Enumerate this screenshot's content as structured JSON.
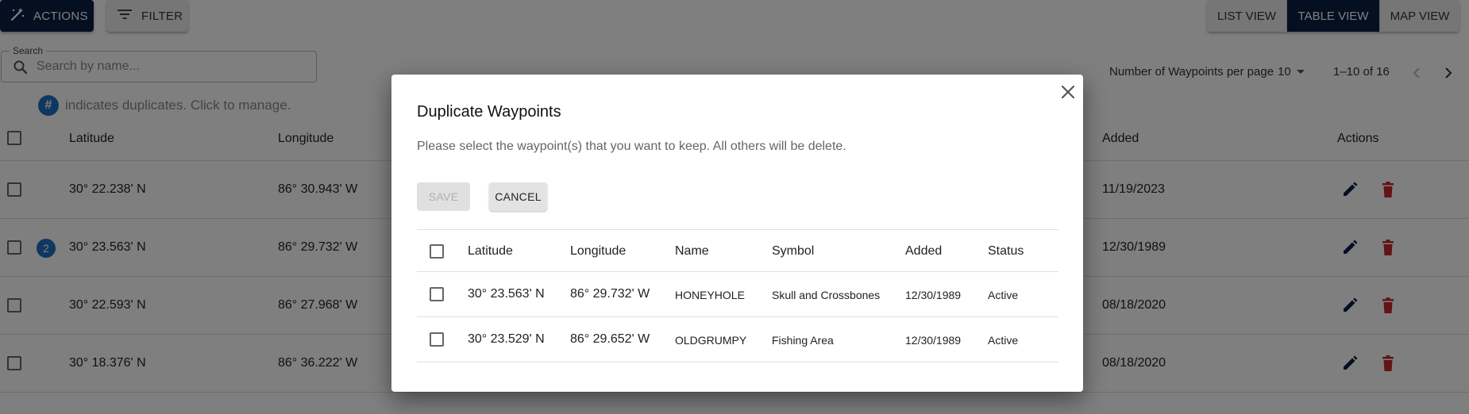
{
  "toolbar": {
    "actions_label": "ACTIONS",
    "filter_label": "FILTER",
    "views": [
      "LIST VIEW",
      "TABLE VIEW",
      "MAP VIEW"
    ],
    "active_view": "TABLE VIEW"
  },
  "search": {
    "legend": "Search",
    "placeholder": "Search by name..."
  },
  "pagination": {
    "per_page_label": "Number of Waypoints per page",
    "per_page_value": "10",
    "range": "1–10 of 16"
  },
  "duplicates_hint": {
    "badge": "#",
    "text": "indicates duplicates. Click to manage."
  },
  "table": {
    "headers": {
      "latitude": "Latitude",
      "longitude": "Longitude",
      "added": "Added",
      "actions": "Actions"
    },
    "rows": [
      {
        "latitude": "30° 22.238' N",
        "longitude": "86° 30.943' W",
        "added": "11/19/2023",
        "dup_count": null
      },
      {
        "latitude": "30° 23.563' N",
        "longitude": "86° 29.732' W",
        "added": "12/30/1989",
        "dup_count": "2"
      },
      {
        "latitude": "30° 22.593' N",
        "longitude": "86° 27.968' W",
        "added": "08/18/2020",
        "dup_count": null
      },
      {
        "latitude": "30° 18.376' N",
        "longitude": "86° 36.222' W",
        "added": "08/18/2020",
        "dup_count": null
      }
    ]
  },
  "dialog": {
    "title": "Duplicate Waypoints",
    "description": "Please select the waypoint(s) that you want to keep. All others will be delete.",
    "save_label": "SAVE",
    "cancel_label": "CANCEL",
    "headers": {
      "latitude": "Latitude",
      "longitude": "Longitude",
      "name": "Name",
      "symbol": "Symbol",
      "added": "Added",
      "status": "Status"
    },
    "rows": [
      {
        "latitude": "30° 23.563' N",
        "longitude": "86° 29.732' W",
        "name": "HONEYHOLE",
        "symbol": "Skull and Crossbones",
        "added": "12/30/1989",
        "status": "Active"
      },
      {
        "latitude": "30° 23.529' N",
        "longitude": "86° 29.652' W",
        "name": "OLDGRUMPY",
        "symbol": "Fishing Area",
        "added": "12/30/1989",
        "status": "Active"
      }
    ]
  },
  "colors": {
    "primary_navy": "#0b1f44",
    "badge_blue": "#1e6fc0",
    "delete_red": "#c62828",
    "edit_navy": "#0b1f44"
  },
  "icons": {
    "actions": "magic-wand-icon",
    "filter": "filter-lines-icon",
    "search": "search-icon",
    "sort": "chevron-down-icon",
    "prev": "chevron-left-icon",
    "next": "chevron-right-icon",
    "edit": "pencil-icon",
    "delete": "trash-icon",
    "close": "close-icon"
  }
}
